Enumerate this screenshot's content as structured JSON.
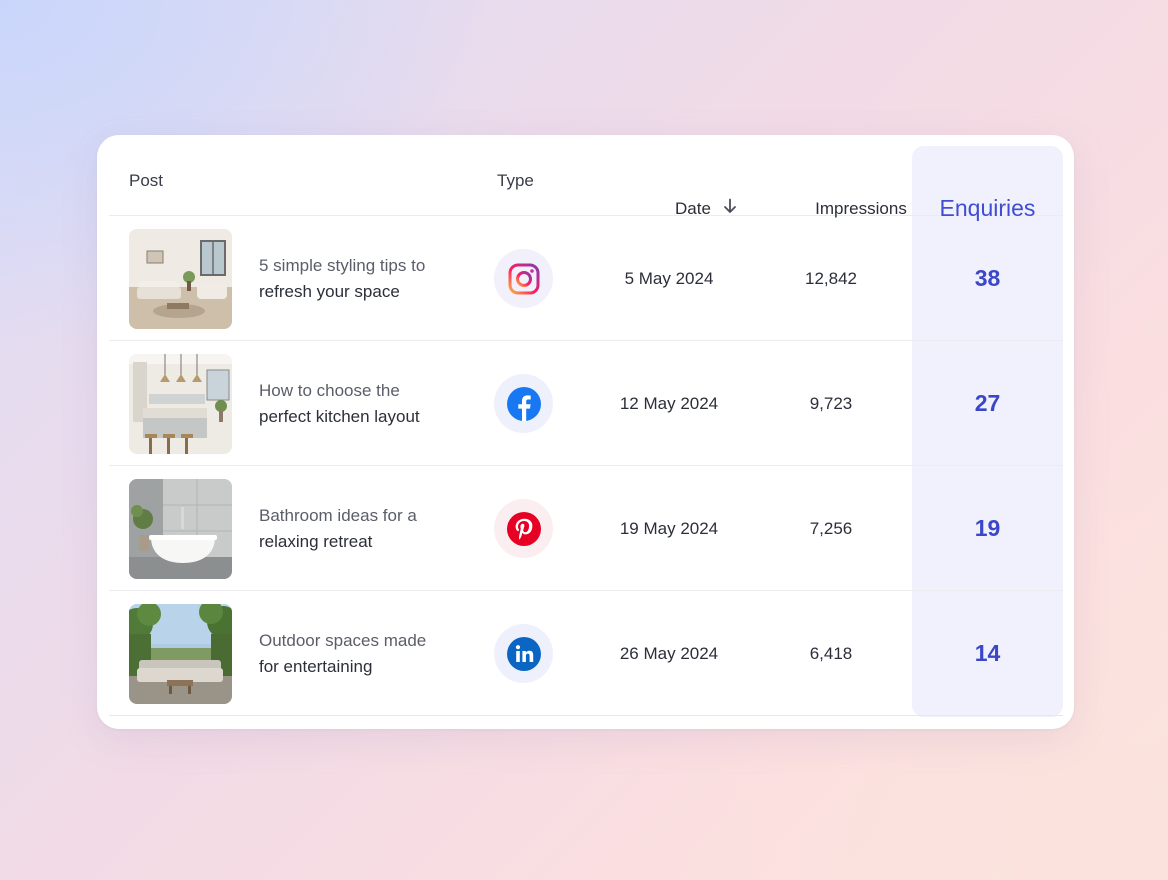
{
  "table": {
    "columns": {
      "post": "Post",
      "type": "Type",
      "date": "Date",
      "date_sort_icon": "arrow-down-icon",
      "impressions": "Impressions",
      "enquiries": "Enquiries"
    },
    "accent_color": "#3a48c8",
    "rows": [
      {
        "title_line1": "5 simple styling tips to",
        "title_line2": "refresh your space",
        "thumbnail": "living-room-photo",
        "type": "instagram-icon",
        "date": "5 May 2024",
        "impressions": "12,842",
        "enquiries": "38"
      },
      {
        "title_line1": "How to choose the",
        "title_line2": "perfect kitchen layout",
        "thumbnail": "kitchen-photo",
        "type": "facebook-icon",
        "date": "12 May 2024",
        "impressions": "9,723",
        "enquiries": "27"
      },
      {
        "title_line1": "Bathroom ideas for a",
        "title_line2": "relaxing retreat",
        "thumbnail": "bathroom-photo",
        "type": "pinterest-icon",
        "date": "19 May 2024",
        "impressions": "7,256",
        "enquiries": "19"
      },
      {
        "title_line1": "Outdoor spaces made",
        "title_line2": "for entertaining",
        "thumbnail": "outdoor-patio-photo",
        "type": "linkedin-icon",
        "date": "26 May 2024",
        "impressions": "6,418",
        "enquiries": "14"
      }
    ]
  }
}
